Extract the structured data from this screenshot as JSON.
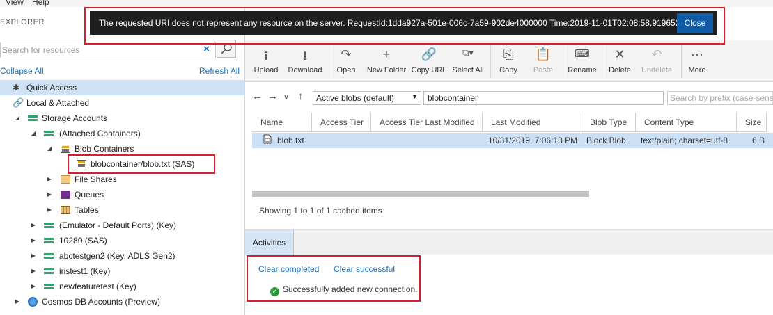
{
  "menu": {
    "items": [
      "View",
      "Help"
    ]
  },
  "explorer": {
    "title": "EXPLORER",
    "search_placeholder": "Search for resources",
    "clear_search": "×",
    "collapse_all": "Collapse All",
    "refresh_all": "Refresh All",
    "tree": [
      {
        "label": "Quick Access",
        "icon": "quick-access-icon"
      },
      {
        "label": "Local & Attached",
        "icon": "link-icon"
      },
      {
        "label": "Storage Accounts",
        "icon": "storage-icon"
      },
      {
        "label": "(Attached Containers)",
        "icon": "storage-icon"
      },
      {
        "label": "Blob Containers",
        "icon": "blob-container-icon"
      },
      {
        "label": "blobcontainer/blob.txt (SAS)",
        "icon": "blob-container-icon"
      },
      {
        "label": "File Shares",
        "icon": "file-share-icon"
      },
      {
        "label": "Queues",
        "icon": "queue-icon"
      },
      {
        "label": "Tables",
        "icon": "table-icon"
      },
      {
        "label": "(Emulator - Default Ports) (Key)",
        "icon": "storage-icon"
      },
      {
        "label": "10280 (SAS)",
        "icon": "storage-icon"
      },
      {
        "label": "abctestgen2 (Key, ADLS Gen2)",
        "icon": "storage-icon"
      },
      {
        "label": "iristest1 (Key)",
        "icon": "storage-icon"
      },
      {
        "label": "newfeaturetest (Key)",
        "icon": "storage-icon"
      },
      {
        "label": "Cosmos DB Accounts (Preview)",
        "icon": "cosmos-icon"
      }
    ]
  },
  "error": {
    "message": "The requested URI does not represent any resource on the server. RequestId:1dda927a-501e-006c-7a59-902de4000000 Time:2019-11-01T02:08:58.919652...",
    "close_label": "Close"
  },
  "toolbar": {
    "upload": "Upload",
    "download": "Download",
    "open": "Open",
    "new_folder": "New Folder",
    "copy_url": "Copy URL",
    "select_all": "Select All",
    "copy": "Copy",
    "paste": "Paste",
    "rename": "Rename",
    "delete": "Delete",
    "undelete": "Undelete",
    "more": "More"
  },
  "nav": {
    "view_select": "Active blobs (default)",
    "path": "blobcontainer",
    "prefix_placeholder": "Search by prefix (case-sensitive)"
  },
  "grid": {
    "columns": [
      "Name",
      "Access Tier",
      "Access Tier Last Modified",
      "Last Modified",
      "Blob Type",
      "Content Type",
      "Size"
    ],
    "rows": [
      {
        "name": "blob.txt",
        "access_tier": "",
        "access_tier_modified": "",
        "last_modified": "10/31/2019, 7:06:13 PM",
        "blob_type": "Block Blob",
        "content_type": "text/plain; charset=utf-8",
        "size": "6 B"
      }
    ],
    "status": "Showing 1 to 1 of 1 cached items"
  },
  "activities": {
    "tab": "Activities",
    "clear_completed": "Clear completed",
    "clear_successful": "Clear successful",
    "message": "Successfully added new connection."
  },
  "colors": {
    "accent": "#0f5ba5",
    "highlight": "#d2202e",
    "selection": "#cce0f5"
  }
}
